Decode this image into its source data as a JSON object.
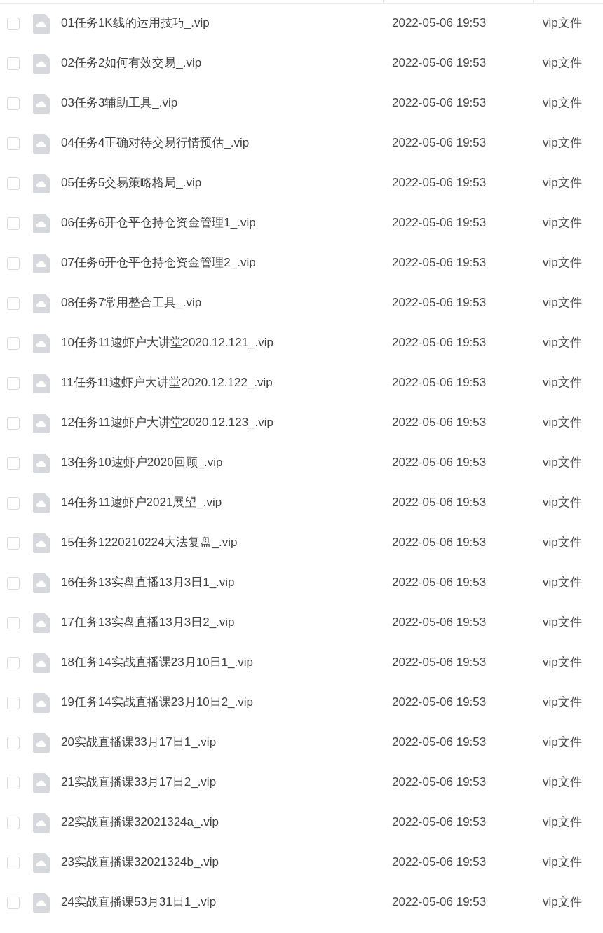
{
  "rows": [
    {
      "checked": false,
      "name": "01任务1K线的运用技巧_.vip",
      "modified": "2022-05-06 19:53",
      "type": "vip文件"
    },
    {
      "checked": false,
      "name": "02任务2如何有效交易_.vip",
      "modified": "2022-05-06 19:53",
      "type": "vip文件"
    },
    {
      "checked": false,
      "name": "03任务3辅助工具_.vip",
      "modified": "2022-05-06 19:53",
      "type": "vip文件"
    },
    {
      "checked": false,
      "name": "04任务4正确对待交易行情预估_.vip",
      "modified": "2022-05-06 19:53",
      "type": "vip文件"
    },
    {
      "checked": false,
      "name": "05任务5交易策略格局_.vip",
      "modified": "2022-05-06 19:53",
      "type": "vip文件"
    },
    {
      "checked": false,
      "name": "06任务6开仓平仓持仓资金管理1_.vip",
      "modified": "2022-05-06 19:53",
      "type": "vip文件"
    },
    {
      "checked": false,
      "name": "07任务6开仓平仓持仓资金管理2_.vip",
      "modified": "2022-05-06 19:53",
      "type": "vip文件"
    },
    {
      "checked": false,
      "name": "08任务7常用整合工具_.vip",
      "modified": "2022-05-06 19:53",
      "type": "vip文件"
    },
    {
      "checked": false,
      "name": "10任务11逮虾户大讲堂2020.12.121_.vip",
      "modified": "2022-05-06 19:53",
      "type": "vip文件"
    },
    {
      "checked": false,
      "name": "11任务11逮虾户大讲堂2020.12.122_.vip",
      "modified": "2022-05-06 19:53",
      "type": "vip文件"
    },
    {
      "checked": false,
      "name": "12任务11逮虾户大讲堂2020.12.123_.vip",
      "modified": "2022-05-06 19:53",
      "type": "vip文件"
    },
    {
      "checked": false,
      "name": "13任务10逮虾户2020回顾_.vip",
      "modified": "2022-05-06 19:53",
      "type": "vip文件"
    },
    {
      "checked": false,
      "name": "14任务11逮虾户2021展望_.vip",
      "modified": "2022-05-06 19:53",
      "type": "vip文件"
    },
    {
      "checked": false,
      "name": "15任务1220210224大法复盘_.vip",
      "modified": "2022-05-06 19:53",
      "type": "vip文件"
    },
    {
      "checked": false,
      "name": "16任务13实盘直播13月3日1_.vip",
      "modified": "2022-05-06 19:53",
      "type": "vip文件"
    },
    {
      "checked": false,
      "name": "17任务13实盘直播13月3日2_.vip",
      "modified": "2022-05-06 19:53",
      "type": "vip文件"
    },
    {
      "checked": false,
      "name": "18任务14实战直播课23月10日1_.vip",
      "modified": "2022-05-06 19:53",
      "type": "vip文件"
    },
    {
      "checked": false,
      "name": "19任务14实战直播课23月10日2_.vip",
      "modified": "2022-05-06 19:53",
      "type": "vip文件"
    },
    {
      "checked": false,
      "name": "20实战直播课33月17日1_.vip",
      "modified": "2022-05-06 19:53",
      "type": "vip文件"
    },
    {
      "checked": false,
      "name": "21实战直播课33月17日2_.vip",
      "modified": "2022-05-06 19:53",
      "type": "vip文件"
    },
    {
      "checked": false,
      "name": "22实战直播课32021324a_.vip",
      "modified": "2022-05-06 19:53",
      "type": "vip文件"
    },
    {
      "checked": false,
      "name": "23实战直播课32021324b_.vip",
      "modified": "2022-05-06 19:53",
      "type": "vip文件"
    },
    {
      "checked": false,
      "name": "24实战直播课53月31日1_.vip",
      "modified": "2022-05-06 19:53",
      "type": "vip文件"
    }
  ]
}
